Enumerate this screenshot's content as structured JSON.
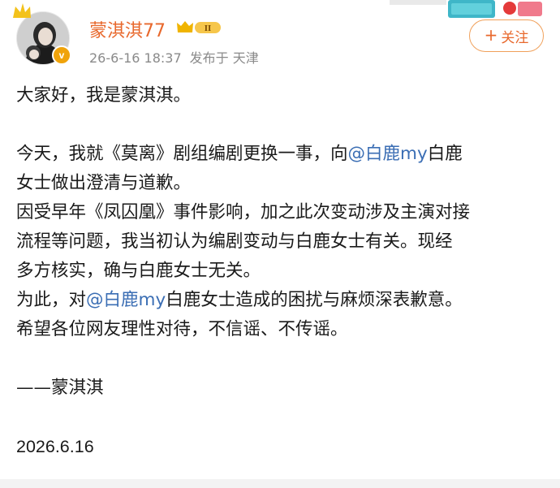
{
  "post": {
    "author_name": "蒙淇淇77",
    "level_badge_text": "II",
    "time": "26-6-16 18:37",
    "publish_prefix": "发布于",
    "location": "天津",
    "follow_label": "关注",
    "verified_mark": "v",
    "lines": [
      {
        "type": "text",
        "text": "大家好，我是蒙淇淇。"
      },
      {
        "type": "blank"
      },
      {
        "type": "mention",
        "before": "今天，我就《莫离》剧组编剧更换一事，向",
        "mention": "@白鹿my",
        "after": "白鹿"
      },
      {
        "type": "text",
        "text": "女士做出澄清与道歉。"
      },
      {
        "type": "text",
        "text": "因受早年《凤囚凰》事件影响，加之此次变动涉及主演对接"
      },
      {
        "type": "text",
        "text": "流程等问题，我当初认为编剧变动与白鹿女士有关。现经"
      },
      {
        "type": "text",
        "text": "多方核实，确与白鹿女士无关。"
      },
      {
        "type": "mention",
        "before": "为此，对",
        "mention": "@白鹿my",
        "after": "白鹿女士造成的困扰与麻烦深表歉意。"
      },
      {
        "type": "text",
        "text": "希望各位网友理性对待，不信谣、不传谣。"
      },
      {
        "type": "blank"
      },
      {
        "type": "text",
        "text": "——蒙淇淇"
      },
      {
        "type": "blank"
      },
      {
        "type": "date",
        "text": "2026.6.16"
      }
    ]
  },
  "colors": {
    "name": "#e8682c",
    "mention": "#3b6eb4",
    "meta": "#8a8a8a",
    "badge_gold": "#f0b400"
  },
  "icons": {
    "avatar": "user-avatar",
    "verified": "verified-badge-icon",
    "level": "crown-level-icon",
    "follow": "plus-icon"
  }
}
